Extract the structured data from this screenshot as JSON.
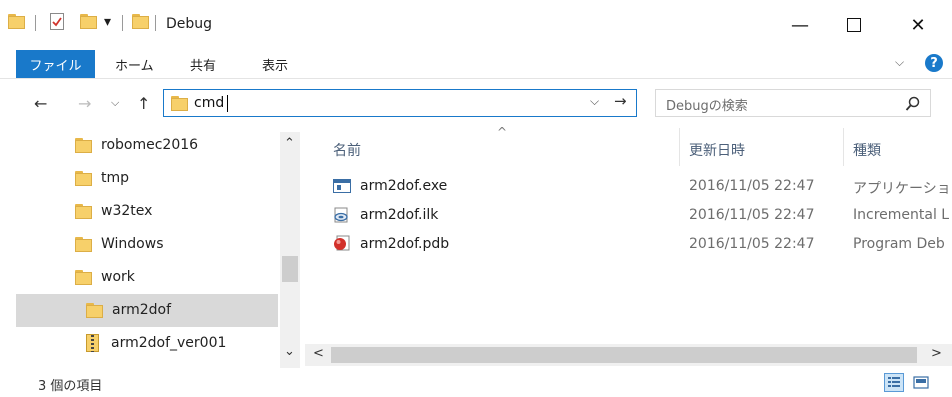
{
  "window": {
    "title": "Debug",
    "quick_access_dropdown": "▾",
    "minimize_glyph": "—",
    "maximize_glyph": "☐",
    "close_glyph": "✕"
  },
  "ribbon": {
    "tabs": [
      "ファイル",
      "ホーム",
      "共有",
      "表示"
    ],
    "expand_glyph": "⌵",
    "help_glyph": "?"
  },
  "address": {
    "value": "cmd",
    "search_placeholder": "Debugの検索",
    "dropdown_glyph": "⌵",
    "go_glyph": "→"
  },
  "nav_buttons": {
    "back": "←",
    "forward": "→",
    "recent": "⌵",
    "up": "↑"
  },
  "nav_pane": {
    "items": [
      {
        "label": "robomec2016",
        "icon": "folder-icon",
        "selected": false
      },
      {
        "label": "tmp",
        "icon": "folder-icon",
        "selected": false
      },
      {
        "label": "w32tex",
        "icon": "folder-icon",
        "selected": false
      },
      {
        "label": "Windows",
        "icon": "folder-icon",
        "selected": false
      },
      {
        "label": "work",
        "icon": "folder-icon",
        "selected": false
      },
      {
        "label": "arm2dof",
        "icon": "folder-icon",
        "selected": true
      },
      {
        "label": "arm2dof_ver001",
        "icon": "zip-folder-icon",
        "selected": false
      }
    ],
    "scroll_up_glyph": "⌃",
    "scroll_down_glyph": "⌄"
  },
  "file_list": {
    "sort_indicator": "^",
    "columns": [
      "名前",
      "更新日時",
      "種類"
    ],
    "rows": [
      {
        "name": "arm2dof.exe",
        "modified": "2016/11/05 22:47",
        "type": "アプリケーション",
        "icon": "exe-icon"
      },
      {
        "name": "arm2dof.ilk",
        "modified": "2016/11/05 22:47",
        "type": "Incremental L",
        "icon": "ilk-icon"
      },
      {
        "name": "arm2dof.pdb",
        "modified": "2016/11/05 22:47",
        "type": "Program Deb",
        "icon": "pdb-icon"
      }
    ],
    "hscroll_left_glyph": "<",
    "hscroll_right_glyph": ">"
  },
  "status": {
    "item_count": "3 個の項目"
  },
  "colors": {
    "accent": "#1979ca",
    "folder": "#f7d06a",
    "selection": "#d9d9d9"
  }
}
